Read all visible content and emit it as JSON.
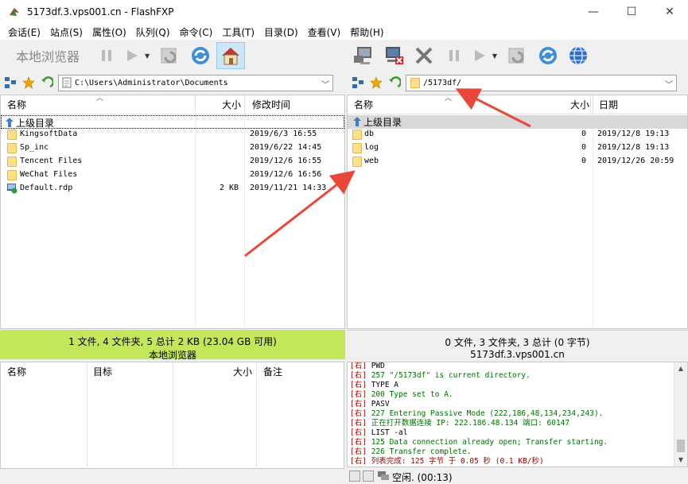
{
  "window": {
    "title": "5173df.3.vps001.cn - FlashFXP",
    "minimize": "—",
    "maximize": "☐",
    "close": "✕"
  },
  "menu": [
    "会话(E)",
    "站点(S)",
    "属性(O)",
    "队列(Q)",
    "命令(C)",
    "工具(T)",
    "目录(D)",
    "查看(V)",
    "帮助(H)"
  ],
  "toolbar_left": {
    "local_browser_label": "本地浏览器"
  },
  "local": {
    "path": "C:\\Users\\Administrator\\Documents",
    "columns": {
      "name": "名称",
      "size": "大小",
      "modified": "修改时间"
    },
    "parent": "上级目录",
    "files": [
      {
        "name": "KingsoftData",
        "size": "",
        "date": "2019/6/3 16:55",
        "type": "folder"
      },
      {
        "name": "Sp_inc",
        "size": "",
        "date": "2019/6/22 14:45",
        "type": "folder"
      },
      {
        "name": "Tencent Files",
        "size": "",
        "date": "2019/12/6 16:55",
        "type": "folder"
      },
      {
        "name": "WeChat Files",
        "size": "",
        "date": "2019/12/6 16:56",
        "type": "folder"
      },
      {
        "name": "Default.rdp",
        "size": "2 KB",
        "date": "2019/11/21 14:33",
        "type": "rdp"
      }
    ],
    "status_line1": "1 文件, 4 文件夹, 5 总计 2 KB (23.04 GB 可用)",
    "status_line2": "本地浏览器"
  },
  "remote": {
    "path": "/5173df/",
    "columns": {
      "name": "名称",
      "size": "大小",
      "date": "日期"
    },
    "parent": "上级目录",
    "files": [
      {
        "name": "db",
        "size": "0",
        "date": "2019/12/8 19:13"
      },
      {
        "name": "log",
        "size": "0",
        "date": "2019/12/8 19:13"
      },
      {
        "name": "web",
        "size": "0",
        "date": "2019/12/26 20:59"
      }
    ],
    "status_line1": "0 文件, 3 文件夹, 3 总计 (0 字节)",
    "status_line2": "5173df.3.vps001.cn"
  },
  "queue": {
    "columns": {
      "name": "名称",
      "target": "目标",
      "size": "大小",
      "note": "备注"
    }
  },
  "log": [
    {
      "tag": "[右]",
      "text": "PWD",
      "color": "black"
    },
    {
      "tag": "[右]",
      "text": "257 \"/5173df\" is current directory.",
      "color": "green"
    },
    {
      "tag": "[右]",
      "text": "TYPE A",
      "color": "black"
    },
    {
      "tag": "[右]",
      "text": "200 Type set to A.",
      "color": "green"
    },
    {
      "tag": "[右]",
      "text": "PASV",
      "color": "black"
    },
    {
      "tag": "[右]",
      "text": "227 Entering Passive Mode (222,186,48,134,234,243).",
      "color": "green"
    },
    {
      "tag": "[右]",
      "text": "正在打开数据连接 IP: 222.186.48.134 端口: 60147",
      "color": "green"
    },
    {
      "tag": "[右]",
      "text": "LIST -al",
      "color": "black"
    },
    {
      "tag": "[右]",
      "text": "125 Data connection already open; Transfer starting.",
      "color": "green"
    },
    {
      "tag": "[右]",
      "text": "226 Transfer complete.",
      "color": "green"
    },
    {
      "tag": "[右]",
      "text": "列表完成: 125 字节 于 0.05 秒 (0.1 KB/秒)",
      "color": "maroon"
    }
  ],
  "bottom_status": "空闲. (00:13)",
  "colors": {
    "local_status_bg": "#c4e65a",
    "arrow": "#e8473a",
    "folder": "#ffe08a"
  }
}
